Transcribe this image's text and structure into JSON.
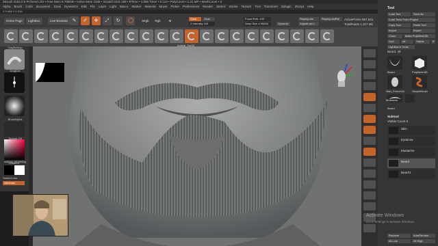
{
  "app": {
    "title": "ZBrush 2022.0.6",
    "subtitle": "Pr:french.zbr",
    "stats": "• Free Mem 6.798GB • Active Mem 2105 • Scratch Disk 159 • RTime • 1.096 Timer • 0.124 • PolyCount • 1.31 MP • MeshCount • 3",
    "right_items": [
      "AC",
      "QuickSave",
      "Menus",
      "DefaultZScript"
    ]
  },
  "menu": [
    "Alpha",
    "Brush",
    "Color",
    "Document",
    "Draw",
    "Dynamics",
    "Edit",
    "File",
    "Layer",
    "Light",
    "Macro",
    "Marker",
    "Material",
    "Movie",
    "Picker",
    "Preferences",
    "Render",
    "Stencil",
    "Stroke",
    "Texture",
    "Tool",
    "Transform",
    "Zplugin",
    "Zscript",
    "Help"
  ],
  "info": "X 0.684 Y 0.316",
  "toolbar": {
    "home": "Home Page",
    "lightbox": "LightBox",
    "live_boolean": "Live Boolean",
    "edit": "Edit",
    "draw": "Draw",
    "move": "Move",
    "scale": "Scale",
    "rotate": "Rotate",
    "mrgb": "Mrgb",
    "rgb": "Rgb",
    "m": "M",
    "zadd": "Zadd",
    "zsub": "Zsub",
    "zcut": "Zcut",
    "rgb_intensity": "Rgb Intensity",
    "z_intensity": "Z Intensity 100",
    "focal_shift": "Focal Shift -100",
    "draw_size": "Draw Size 4.95256",
    "dynamic": "Dynamic",
    "replay_last": "ReplayLast",
    "replay_last_rel": "ReplayLastRel",
    "adjust_last": "AdjustLast 1",
    "active_points": "ActivePoints 957,941",
    "total_points": "TotalPoints 1,327 Mil"
  },
  "shelf": {
    "brush_caption": "Animal_Fur03",
    "count": 22
  },
  "left_panel": {
    "items": [
      {
        "label": "ClayBuildup"
      },
      {
        "label": "DragDot"
      },
      {
        "label": "BrushAlpha"
      },
      {
        "label": "Texture Off"
      },
      {
        "label": "matcap_Modelling"
      },
      {
        "label": "Gradient"
      },
      {
        "label": "SwitchColor"
      },
      {
        "label": "Alternate"
      }
    ]
  },
  "tool_panel": {
    "header": "Tool",
    "buttons": [
      "Load Tool",
      "Save As",
      "Load Tools From Project",
      "Copy Tool",
      "Paste Tool",
      "Import",
      "Export",
      "Clone",
      "Make PolyMesh3D",
      "GoZ",
      "All",
      "Visible",
      "R"
    ],
    "lightbox_tools": "Lightbox ▸ Tools",
    "beard_count": "Beard. 48",
    "tools": [
      "Beard",
      "PolyMesh3D",
      "Skin_French16",
      "SimpleBrush",
      "Mustache",
      "Beard"
    ],
    "subtool_header": "Subtool",
    "visible_count": "Visible Count 8",
    "subtools": [
      "Skin",
      "Eyebrow",
      "Mustache",
      "Beard",
      "Beard1"
    ],
    "bottom": [
      "Rename",
      "AutoReorder",
      "All Low",
      "All High"
    ]
  },
  "watermark": {
    "line1": "Activate Windows",
    "line2": "Go to Settings to activate Windows."
  },
  "colors": {
    "accent": "#c5632b",
    "viewport": "#7b7e7d",
    "panel": "#353535"
  }
}
